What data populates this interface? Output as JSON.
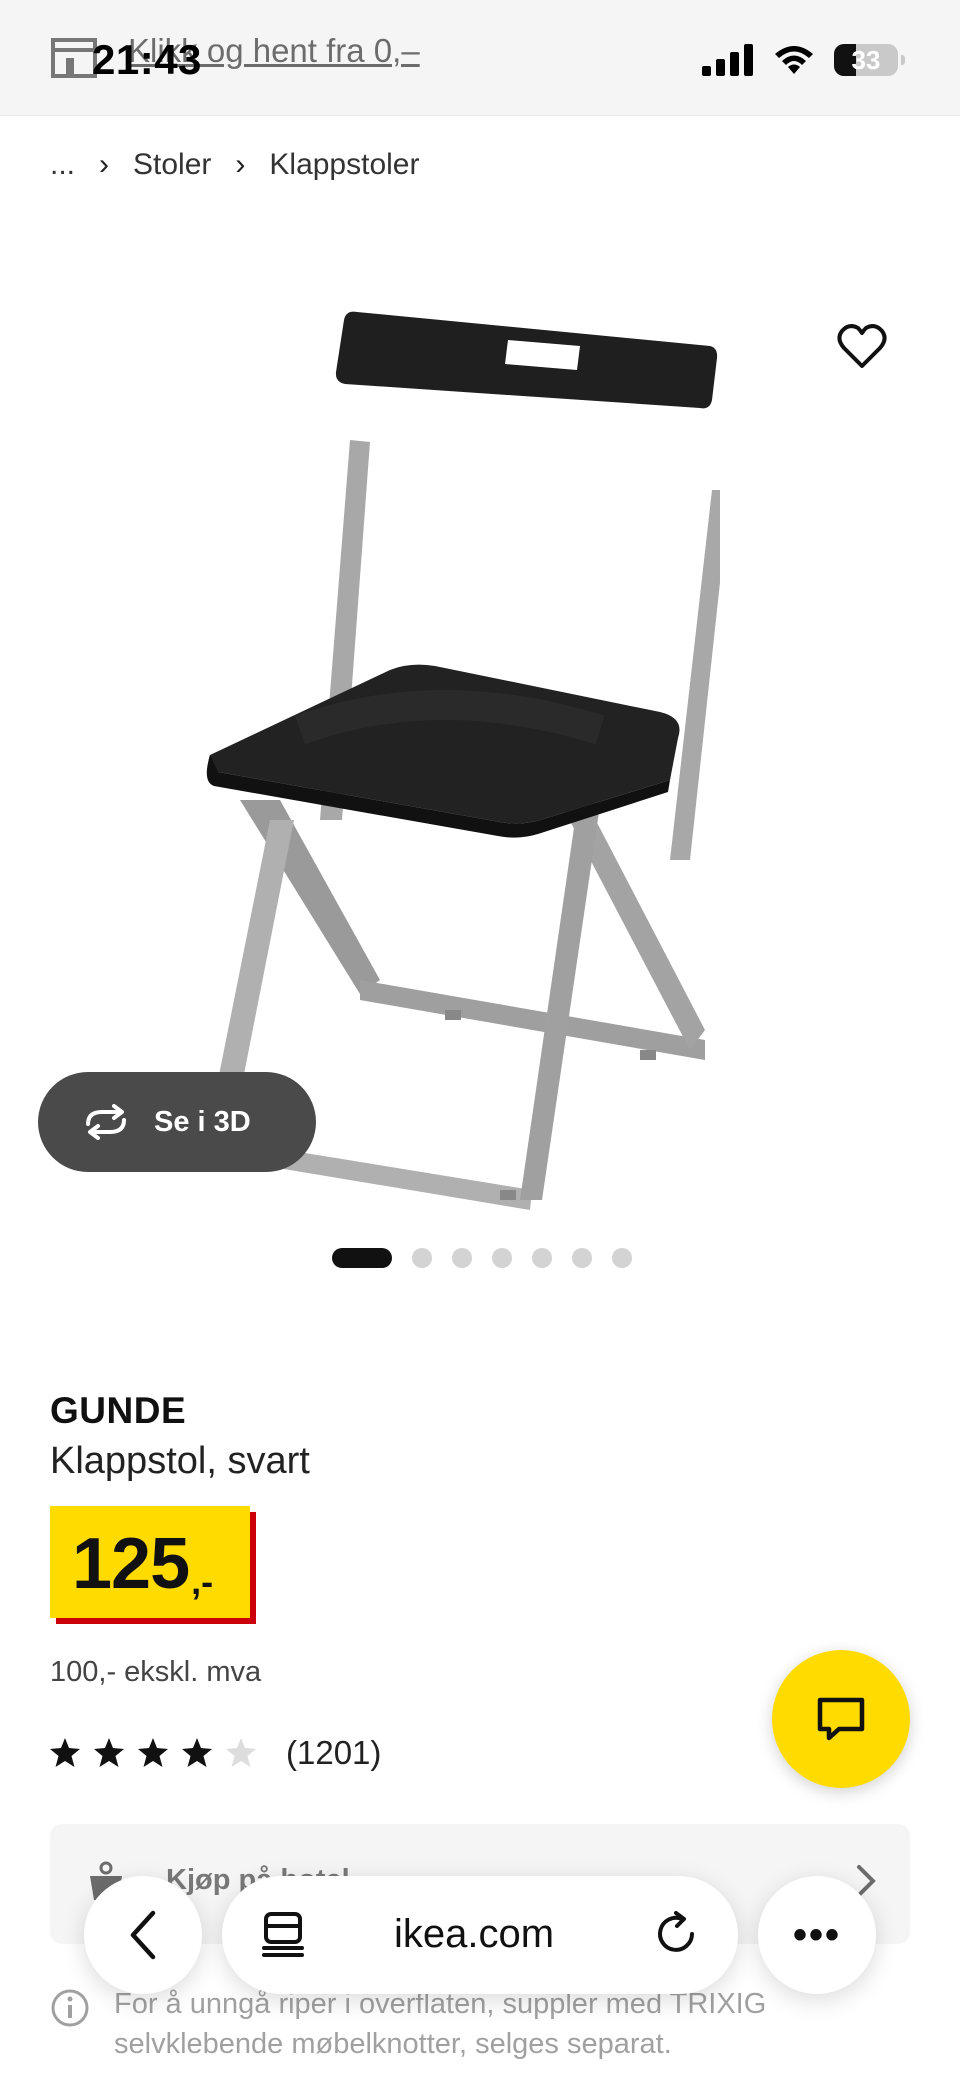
{
  "status_bar": {
    "time": "21:43",
    "battery": "33",
    "promo_text": "Klikk og hent fra 0,–"
  },
  "breadcrumb": {
    "items": [
      "...",
      "Stoler",
      "Klappstoler"
    ],
    "separator": "›"
  },
  "gallery": {
    "view_3d_label": "Se i 3D",
    "image_count": 7,
    "active_index": 0
  },
  "product": {
    "name": "GUNDE",
    "description": "Klappstol, svart",
    "price": "125",
    "price_suffix": ",-",
    "price_ex_vat": "100,- ekskl. mva",
    "rating": 4.5,
    "rating_count": "(1201)"
  },
  "store_card": {
    "label": "Kjøp på hotel"
  },
  "info_note": {
    "text": "For å unngå riper i overflaten, suppler med TRIXIG selvklebende møbelknotter, selges separat."
  },
  "browser": {
    "url": "ikea.com",
    "more_label": "•••"
  },
  "colors": {
    "price_yellow": "#ffdb00",
    "price_red": "#cc0008",
    "chat_yellow": "#ffdb00"
  }
}
